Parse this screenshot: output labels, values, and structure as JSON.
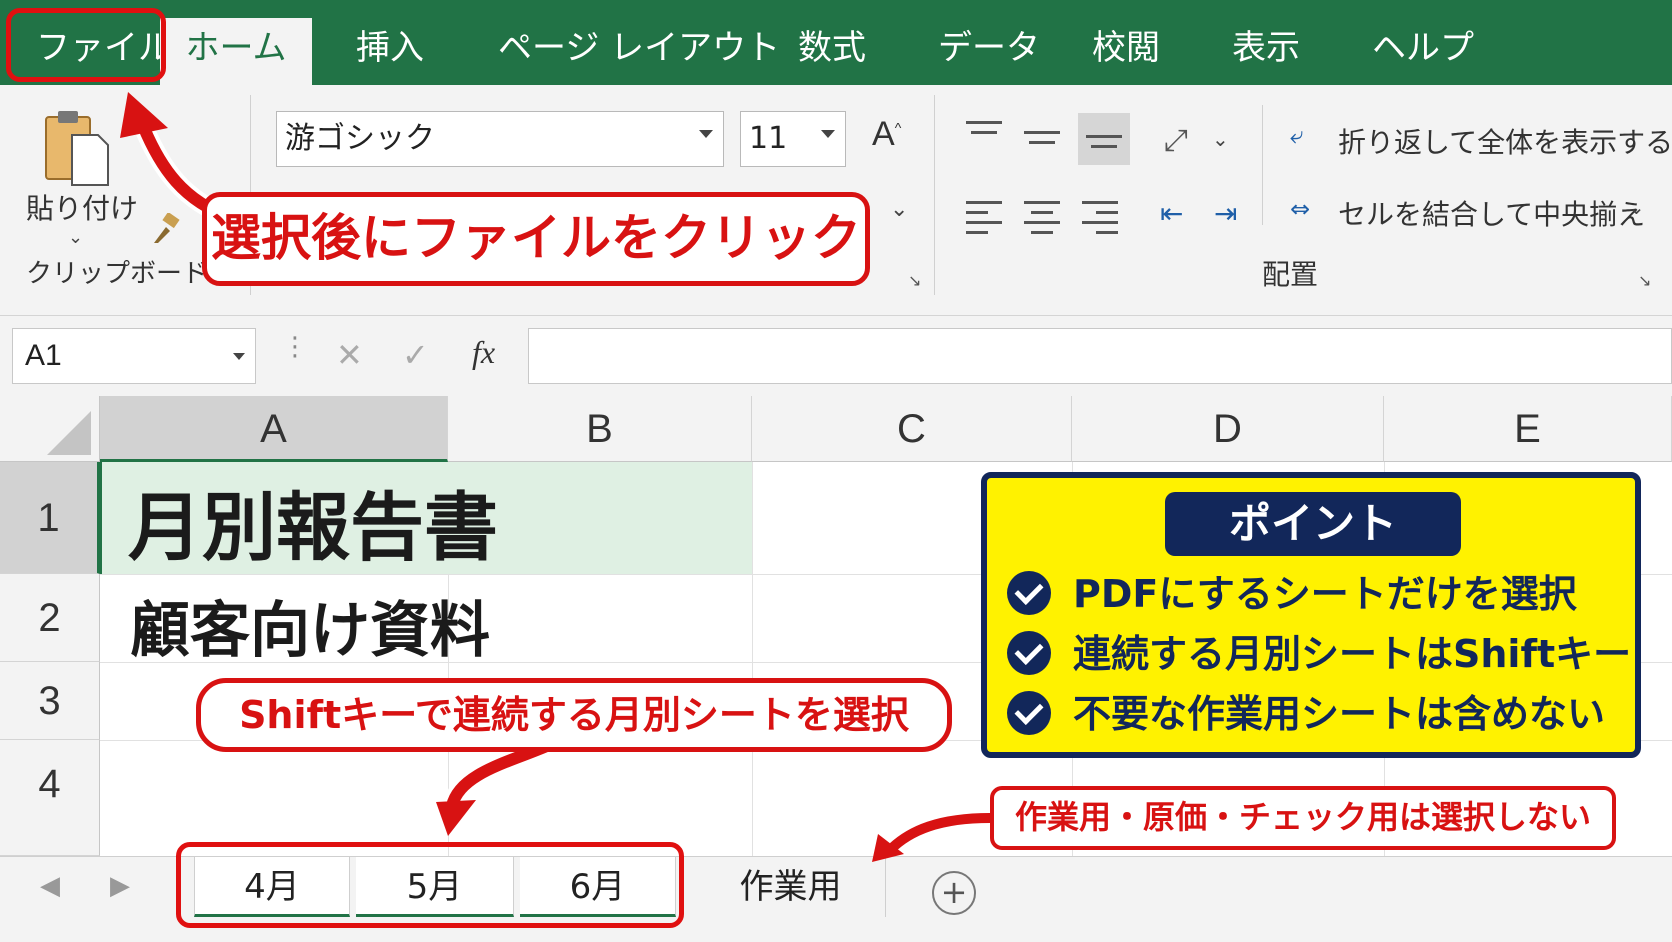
{
  "ribbon_tabs": [
    "ファイル",
    "ホーム",
    "挿入",
    "ページ レイアウト",
    "数式",
    "データ",
    "校閲",
    "表示",
    "ヘルプ"
  ],
  "clipboard": {
    "paste_label": "貼り付け",
    "group_label": "クリップボード"
  },
  "font": {
    "name": "游ゴシック",
    "size": "11",
    "grow_label": "A"
  },
  "alignment": {
    "wrap_label": "折り返して全体を表示する",
    "merge_label": "セルを結合して中央揃え",
    "group_label": "配置"
  },
  "formula_bar": {
    "name_box": "A1",
    "fx": "fx",
    "value": ""
  },
  "columns": [
    "A",
    "B",
    "C",
    "D",
    "E"
  ],
  "rows": [
    "1",
    "2",
    "3",
    "4"
  ],
  "cells": {
    "A1": "月別報告書",
    "A2": "顧客向け資料"
  },
  "sheet_tabs": [
    "4月",
    "5月",
    "6月",
    "作業用"
  ],
  "annotations": {
    "file_callout": "選択後にファイルをクリック",
    "shift_callout": "Shiftキーで連続する月別シートを選択",
    "exclude_callout": "作業用・原価・チェック用は選択しない",
    "point_title": "ポイント",
    "points": [
      "PDFにするシートだけを選択",
      "連続する月別シートはShiftキー",
      "不要な作業用シートは含めない"
    ]
  },
  "colors": {
    "excel_green": "#217346",
    "annotation_red": "#e01010",
    "point_yellow": "#fff200",
    "point_navy": "#12275a"
  }
}
